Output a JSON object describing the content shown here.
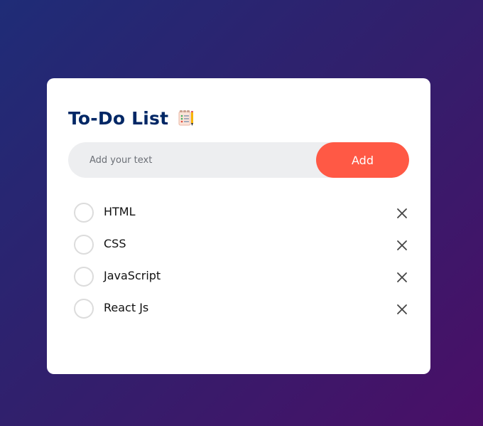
{
  "todo": {
    "title": "To-Do List",
    "title_icon": "notepad-checklist-icon",
    "input": {
      "placeholder": "Add your text",
      "value": ""
    },
    "add_label": "Add",
    "items": [
      {
        "label": "HTML",
        "checked": false
      },
      {
        "label": "CSS",
        "checked": false
      },
      {
        "label": "JavaScript",
        "checked": false
      },
      {
        "label": "React Js",
        "checked": false
      }
    ],
    "delete_icon": "close-icon"
  },
  "colors": {
    "title": "#002765",
    "accent": "#ff5945",
    "input_bg": "#edeef0",
    "background_start": "#1f2c77",
    "background_end": "#4a0f67"
  }
}
